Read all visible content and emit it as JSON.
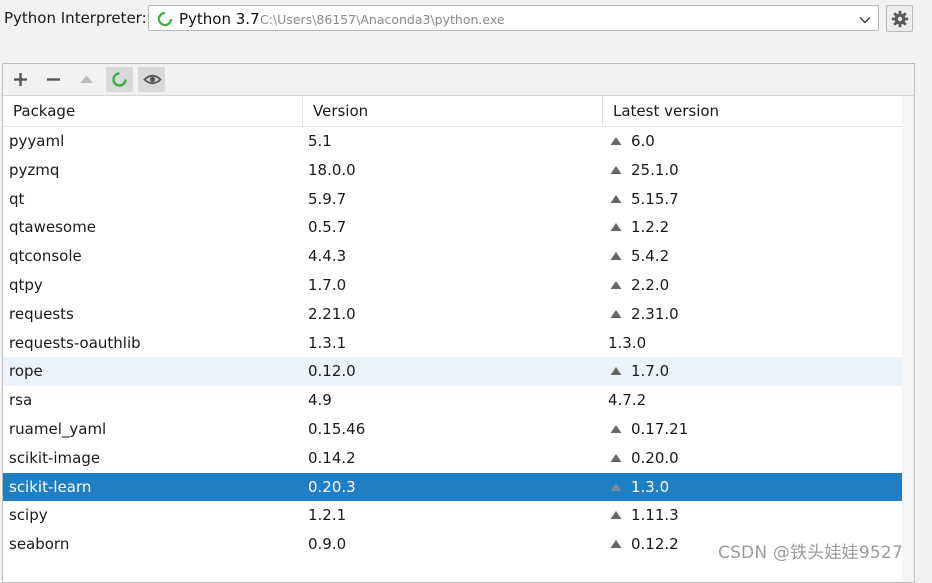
{
  "interpreter": {
    "label": "Python Interpreter:",
    "name": "Python 3.7",
    "path": "C:\\Users\\86157\\Anaconda3\\python.exe"
  },
  "table": {
    "columns": [
      "Package",
      "Version",
      "Latest version"
    ],
    "rows": [
      {
        "package": "pyyaml",
        "version": "5.1",
        "latest": "6.0",
        "upgrade": true
      },
      {
        "package": "pyzmq",
        "version": "18.0.0",
        "latest": "25.1.0",
        "upgrade": true
      },
      {
        "package": "qt",
        "version": "5.9.7",
        "latest": "5.15.7",
        "upgrade": true
      },
      {
        "package": "qtawesome",
        "version": "0.5.7",
        "latest": "1.2.2",
        "upgrade": true
      },
      {
        "package": "qtconsole",
        "version": "4.4.3",
        "latest": "5.4.2",
        "upgrade": true
      },
      {
        "package": "qtpy",
        "version": "1.7.0",
        "latest": "2.2.0",
        "upgrade": true
      },
      {
        "package": "requests",
        "version": "2.21.0",
        "latest": "2.31.0",
        "upgrade": true
      },
      {
        "package": "requests-oauthlib",
        "version": "1.3.1",
        "latest": "1.3.0",
        "upgrade": false
      },
      {
        "package": "rope",
        "version": "0.12.0",
        "latest": "1.7.0",
        "upgrade": true,
        "state": "hover"
      },
      {
        "package": "rsa",
        "version": "4.9",
        "latest": "4.7.2",
        "upgrade": false
      },
      {
        "package": "ruamel_yaml",
        "version": "0.15.46",
        "latest": "0.17.21",
        "upgrade": true
      },
      {
        "package": "scikit-image",
        "version": "0.14.2",
        "latest": "0.20.0",
        "upgrade": true
      },
      {
        "package": "scikit-learn",
        "version": "0.20.3",
        "latest": "1.3.0",
        "upgrade": true,
        "state": "selected"
      },
      {
        "package": "scipy",
        "version": "1.2.1",
        "latest": "1.11.3",
        "upgrade": true
      },
      {
        "package": "seaborn",
        "version": "0.9.0",
        "latest": "0.12.2",
        "upgrade": true
      }
    ]
  },
  "icons": {
    "add": "plus-icon",
    "remove": "minus-icon",
    "upgrade": "upgrade-arrow-icon",
    "loading": "loading-spinner-icon",
    "show": "eye-icon",
    "settings": "gear-icon"
  },
  "colors": {
    "selected_row": "#1f7ec4",
    "hover_row": "#edf3fb",
    "spinner": "#3fae49"
  },
  "watermark": "CSDN @铁头娃娃9527"
}
